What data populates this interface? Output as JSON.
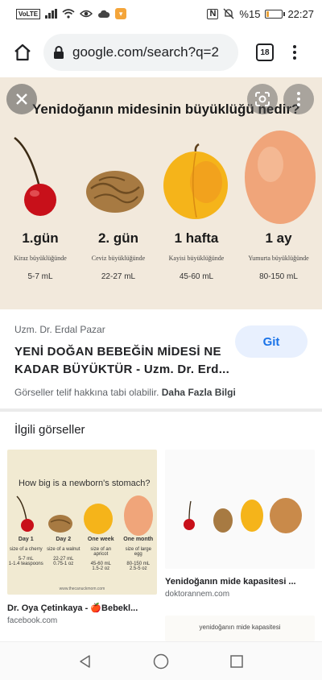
{
  "status": {
    "volte": "VoLTE",
    "nfc": "N",
    "battery_text": "%15",
    "battery_level": 0.15,
    "time": "22:27"
  },
  "browser": {
    "url": "google.com/search?q=2",
    "tab_count": "18"
  },
  "hero": {
    "title": "Yenidoğanın midesinin büyüklüğü nedir?",
    "stages": [
      {
        "day": "1.gün",
        "size": "Kiraz büyüklüğünde",
        "volume": "5-7 mL"
      },
      {
        "day": "2. gün",
        "size": "Ceviz büyüklüğünde",
        "volume": "22-27 mL"
      },
      {
        "day": "1 hafta",
        "size": "Kayisi büyüklüğünde",
        "volume": "45-60 mL"
      },
      {
        "day": "1 ay",
        "size": "Yumurta büyüklüğünde",
        "volume": "80-150 mL"
      }
    ]
  },
  "result": {
    "source": "Uzm. Dr. Erdal Pazar",
    "title": "YENİ DOĞAN BEBEĞİN MİDESİ NE KADAR BÜYÜKTÜR - Uzm. Dr. Erd...",
    "copyright": "Görseller telif hakkına tabi olabilir.",
    "more_info": "Daha Fazla Bilgi",
    "go_label": "Git"
  },
  "related": {
    "heading": "İlgili görseller",
    "cards": [
      {
        "title": "Dr. Oya Çetinkaya - 🍎Bebekl...",
        "site": "facebook.com",
        "image_title": "How big is a newborn's stomach?",
        "stages": [
          {
            "day": "Day 1",
            "size": "size of a cherry",
            "vol": "5-7 mL\n1-1.4 teaspoons"
          },
          {
            "day": "Day 2",
            "size": "size of a walnut",
            "vol": "22-27 mL\n0.75-1 oz"
          },
          {
            "day": "One week",
            "size": "size of an apricot",
            "vol": "45-60 mL\n1.5-2 oz"
          },
          {
            "day": "One month",
            "size": "size of large egg",
            "vol": "80-150 mL\n2.5-5 oz"
          }
        ],
        "footer": "www.thecanuckmom.com"
      },
      {
        "title": "Yenidoğanın mide kapasitesi ...",
        "site": "doktorannem.com"
      },
      {
        "image_title": "yenidoğanın mide kapasitesi"
      }
    ]
  },
  "icons": {
    "home": "home-icon",
    "lock": "lock-icon",
    "close": "close-icon",
    "lens": "lens-icon",
    "more": "more-vert-icon",
    "back": "nav-back-icon",
    "home_nav": "nav-home-icon",
    "recents": "nav-recents-icon"
  }
}
